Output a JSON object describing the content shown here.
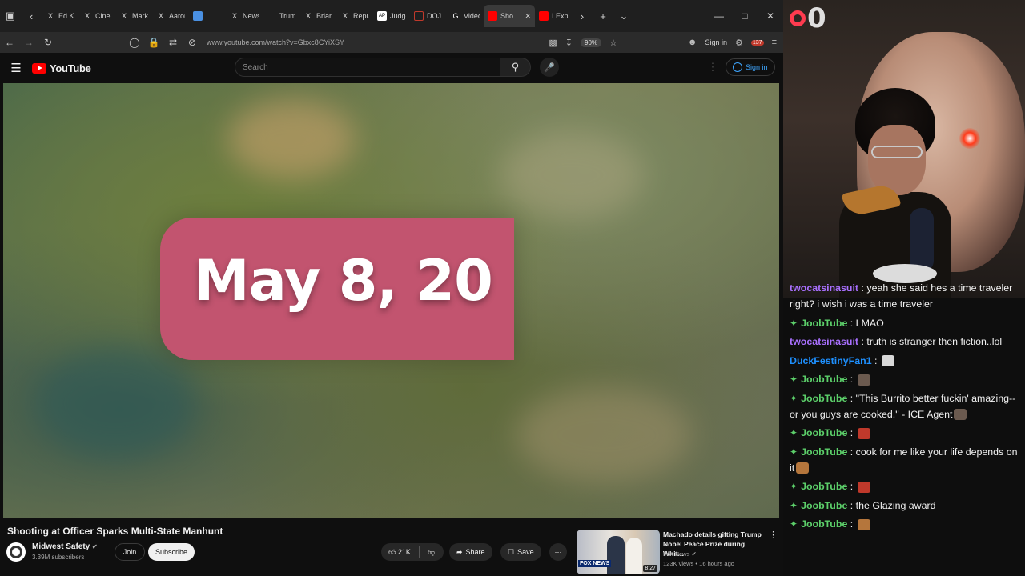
{
  "browser": {
    "tabs": [
      {
        "label": "Ed Kr",
        "icon": "x-icon",
        "color": "#000000"
      },
      {
        "label": "Cinem",
        "icon": "x-icon",
        "color": "#000000"
      },
      {
        "label": "Mark",
        "icon": "x-icon",
        "color": "#000000"
      },
      {
        "label": "Aaron",
        "icon": "x-icon",
        "color": "#000000"
      },
      {
        "label": "",
        "icon": "blue-square-icon",
        "color": "#4a90e2"
      },
      {
        "label": "News",
        "icon": "x-icon",
        "color": "#000000"
      },
      {
        "label": "Trump",
        "icon": "",
        "color": ""
      },
      {
        "label": "Brian",
        "icon": "x-icon",
        "color": "#000000"
      },
      {
        "label": "Repub",
        "icon": "x-icon",
        "color": "#000000"
      },
      {
        "label": "Judge",
        "icon": "ap-icon",
        "color": "#111111"
      },
      {
        "label": "DOJ",
        "icon": "red-icon",
        "color": "#c0392b"
      },
      {
        "label": "Video",
        "icon": "g-icon",
        "color": "#222222"
      },
      {
        "label": "Sho",
        "icon": "youtube-icon",
        "color": "#ff0000",
        "active": true
      },
      {
        "label": "I Exp",
        "icon": "youtube-icon",
        "color": "#ff0000"
      }
    ],
    "url": "www.youtube.com/watch?v=Gbxc8CYiXSY",
    "zoom": "90%",
    "signin_label": "Sign in",
    "badge_count": "137"
  },
  "youtube": {
    "logo_text": "YouTube",
    "search_placeholder": "Search",
    "signin_label": "Sign in",
    "video": {
      "overlay_text": "May 8, 20",
      "title": "Shooting at Officer Sparks Multi-State Manhunt"
    },
    "channel": {
      "name": "Midwest Safety",
      "subscribers": "3.39M subscribers",
      "join_label": "Join",
      "subscribe_label": "Subscribe"
    },
    "actions": {
      "likes": "21K",
      "share_label": "Share",
      "save_label": "Save"
    },
    "recommendation": {
      "title": "Machado details gifting Trump Nobel Peace Prize during Whit...",
      "channel": "Fox News",
      "meta": "123K views • 16 hours ago",
      "duration": "8:27",
      "thumb_badge": "FOX NEWS"
    }
  },
  "stream": {
    "counter": "0",
    "accent": "#ff3b4f"
  },
  "chat": {
    "messages": [
      {
        "name": "twocatsinasuit",
        "name_color": "#a970ff",
        "badge": false,
        "text": "yeah she said hes a time traveler right? i wish i was a time traveler"
      },
      {
        "name": "JoobTube",
        "name_color": "#5ccf6a",
        "badge": true,
        "text": "LMAO"
      },
      {
        "name": "twocatsinasuit",
        "name_color": "#a970ff",
        "badge": false,
        "text": "truth is stranger then fiction..lol"
      },
      {
        "name": "DuckFestinyFan1",
        "name_color": "#1e90ff",
        "badge": false,
        "text": "",
        "emote": "skull-emote"
      },
      {
        "name": "JoobTube",
        "name_color": "#5ccf6a",
        "badge": true,
        "text": "",
        "emote": "face-emote"
      },
      {
        "name": "JoobTube",
        "name_color": "#5ccf6a",
        "badge": true,
        "text": "\"This Burrito better fuckin' amazing-- or you guys are cooked.\" - ICE Agent",
        "emote": "face-emote"
      },
      {
        "name": "JoobTube",
        "name_color": "#5ccf6a",
        "badge": true,
        "text": "",
        "emote": "devil-emote"
      },
      {
        "name": "JoobTube",
        "name_color": "#5ccf6a",
        "badge": true,
        "text": "cook for me like your life depends on it",
        "emote": "chef-emote"
      },
      {
        "name": "JoobTube",
        "name_color": "#5ccf6a",
        "badge": true,
        "text": "",
        "emote": "devil-emote"
      },
      {
        "name": "JoobTube",
        "name_color": "#5ccf6a",
        "badge": true,
        "text": "the Glazing award"
      },
      {
        "name": "JoobTube",
        "name_color": "#5ccf6a",
        "badge": true,
        "text": "",
        "emote": "chef-emote"
      }
    ]
  }
}
